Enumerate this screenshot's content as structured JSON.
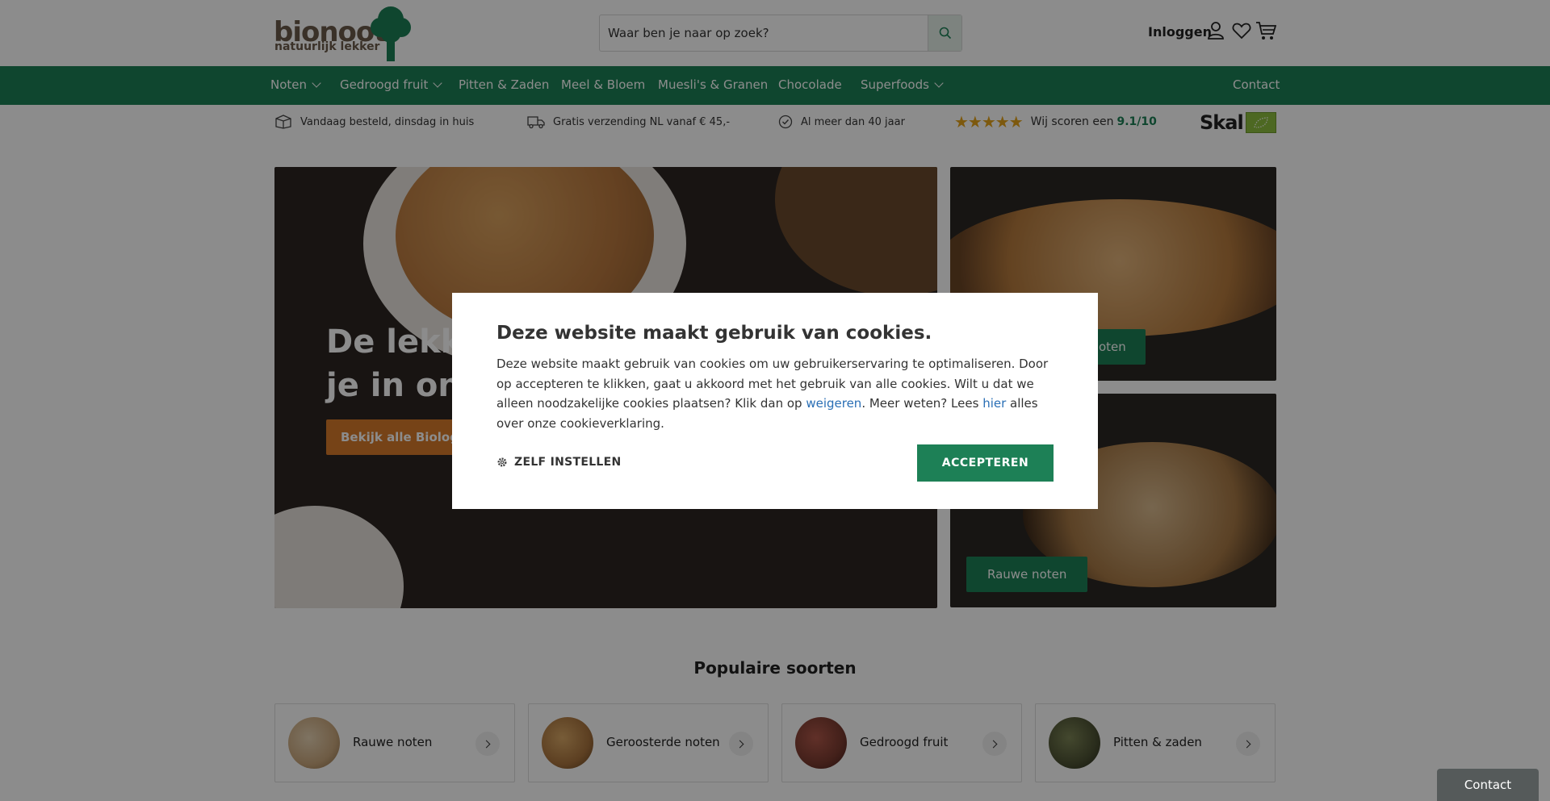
{
  "header": {
    "logo_word": "bionoot",
    "logo_sub": "natuurlijk lekker",
    "search_placeholder": "Waar ben je naar op zoek?",
    "login_label": "Inloggen"
  },
  "nav": {
    "items": [
      {
        "label": "Noten",
        "dropdown": true
      },
      {
        "label": "Gedroogd fruit",
        "dropdown": true
      },
      {
        "label": "Pitten & Zaden",
        "dropdown": false
      },
      {
        "label": "Meel & Bloem",
        "dropdown": false
      },
      {
        "label": "Muesli's & Granen",
        "dropdown": false
      },
      {
        "label": "Chocolade",
        "dropdown": false
      },
      {
        "label": "Superfoods",
        "dropdown": true
      }
    ],
    "contact_label": "Contact"
  },
  "usp": {
    "delivery": "Vandaag besteld, dinsdag in huis",
    "shipping": "Gratis verzending NL vanaf € 45,-",
    "years": "Al meer dan 40 jaar",
    "rating_prefix": "Wij scoren een",
    "rating_value": "9.1/10",
    "stars": "★★★★★",
    "skal": "Skal"
  },
  "hero": {
    "title_line1": "De lekke",
    "title_line2": "je in ons",
    "button_label": "Bekijk alle Biologisc"
  },
  "tiles": {
    "top_button": "oten",
    "bottom_button": "Rauwe noten"
  },
  "popular": {
    "title": "Populaire soorten",
    "categories": [
      {
        "label": "Rauwe noten",
        "color": "#c9a77d"
      },
      {
        "label": "Geroosterde noten",
        "color": "#a9743e"
      },
      {
        "label": "Gedroogd fruit",
        "color": "#7a3b30"
      },
      {
        "label": "Pitten & zaden",
        "color": "#4d5234"
      }
    ]
  },
  "cookie": {
    "title": "Deze website maakt gebruik van cookies.",
    "text_1": "Deze website maakt gebruik van cookies om uw gebruikerservaring te optimaliseren. Door op accepteren te klikken, gaat u akkoord met het gebruik van alle cookies. Wilt u dat we alleen noodzakelijke cookies plaatsen? Klik dan op ",
    "link_refuse": "weigeren",
    "text_2": ". Meer weten? Lees ",
    "link_here": "hier",
    "text_3": " alles over onze cookieverklaring.",
    "settings_label": "ZELF INSTELLEN",
    "accept_label": "ACCEPTEREN"
  },
  "contact_tab": "Contact",
  "colors": {
    "brand_green": "#1d8056",
    "hero_button": "#d77a2a",
    "link_blue": "#2a6fb5"
  }
}
